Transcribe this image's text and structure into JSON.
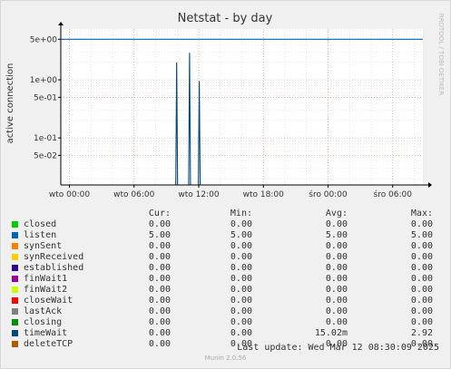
{
  "chart_data": {
    "type": "line",
    "title": "Netstat - by day",
    "ylabel": "active connection",
    "side_label": "RRDTOOL / TOBI OETIKER",
    "yscale": "log",
    "ylim": [
      0.0155,
      7.5
    ],
    "y_ticks": [
      {
        "value": 5,
        "label": "5e+00"
      },
      {
        "value": 1,
        "label": "1e+00"
      },
      {
        "value": 0.5,
        "label": "5e-01"
      },
      {
        "value": 0.1,
        "label": "1e-01"
      },
      {
        "value": 0.05,
        "label": "5e-02"
      }
    ],
    "x_ticks": [
      "wto 00:00",
      "wto 06:00",
      "wto 12:00",
      "wto 18:00",
      "śro 00:00",
      "śro 06:00"
    ],
    "x_tick_hours": [
      0,
      6,
      12,
      18,
      24,
      30
    ],
    "xlim_hours": [
      -0.8,
      32.8
    ],
    "grid": true,
    "series": [
      {
        "name": "closed",
        "color": "#00cc00",
        "points": []
      },
      {
        "name": "listen",
        "color": "#0066b3",
        "points": [
          [
            -0.8,
            5
          ],
          [
            32.8,
            5
          ]
        ]
      },
      {
        "name": "synSent",
        "color": "#ff8000",
        "points": []
      },
      {
        "name": "synReceived",
        "color": "#ffcc00",
        "points": []
      },
      {
        "name": "established",
        "color": "#330099",
        "points": []
      },
      {
        "name": "finWait1",
        "color": "#990099",
        "points": []
      },
      {
        "name": "finWait2",
        "color": "#ccff00",
        "points": []
      },
      {
        "name": "closeWait",
        "color": "#ff0000",
        "points": []
      },
      {
        "name": "lastAck",
        "color": "#808080",
        "points": []
      },
      {
        "name": "closing",
        "color": "#008f00",
        "points": []
      },
      {
        "name": "timeWait",
        "color": "#00487d",
        "spikes": [
          [
            9.95,
            2.0
          ],
          [
            11.15,
            2.92
          ],
          [
            12.05,
            0.95
          ]
        ]
      },
      {
        "name": "deleteTCP",
        "color": "#b35a00",
        "points": []
      }
    ]
  },
  "legend": {
    "headers": {
      "cur": "Cur:",
      "min": "Min:",
      "avg": "Avg:",
      "max": "Max:"
    },
    "rows": [
      {
        "name": "closed",
        "color": "#00cc00",
        "cur": "0.00",
        "min": "0.00",
        "avg": "0.00",
        "max": "0.00"
      },
      {
        "name": "listen",
        "color": "#0066b3",
        "cur": "5.00",
        "min": "5.00",
        "avg": "5.00",
        "max": "5.00"
      },
      {
        "name": "synSent",
        "color": "#ff8000",
        "cur": "0.00",
        "min": "0.00",
        "avg": "0.00",
        "max": "0.00"
      },
      {
        "name": "synReceived",
        "color": "#ffcc00",
        "cur": "0.00",
        "min": "0.00",
        "avg": "0.00",
        "max": "0.00"
      },
      {
        "name": "established",
        "color": "#330099",
        "cur": "0.00",
        "min": "0.00",
        "avg": "0.00",
        "max": "0.00"
      },
      {
        "name": "finWait1",
        "color": "#990099",
        "cur": "0.00",
        "min": "0.00",
        "avg": "0.00",
        "max": "0.00"
      },
      {
        "name": "finWait2",
        "color": "#ccff00",
        "cur": "0.00",
        "min": "0.00",
        "avg": "0.00",
        "max": "0.00"
      },
      {
        "name": "closeWait",
        "color": "#ff0000",
        "cur": "0.00",
        "min": "0.00",
        "avg": "0.00",
        "max": "0.00"
      },
      {
        "name": "lastAck",
        "color": "#808080",
        "cur": "0.00",
        "min": "0.00",
        "avg": "0.00",
        "max": "0.00"
      },
      {
        "name": "closing",
        "color": "#008f00",
        "cur": "0.00",
        "min": "0.00",
        "avg": "0.00",
        "max": "0.00"
      },
      {
        "name": "timeWait",
        "color": "#00487d",
        "cur": "0.00",
        "min": "0.00",
        "avg": "15.02m",
        "max": "2.92"
      },
      {
        "name": "deleteTCP",
        "color": "#b35a00",
        "cur": "0.00",
        "min": "0.00",
        "avg": "0.00",
        "max": "0.00"
      }
    ]
  },
  "footer": {
    "last_update": "Last update: Wed Mar 12 08:30:09 2025",
    "generator": "Munin 2.0.56"
  }
}
